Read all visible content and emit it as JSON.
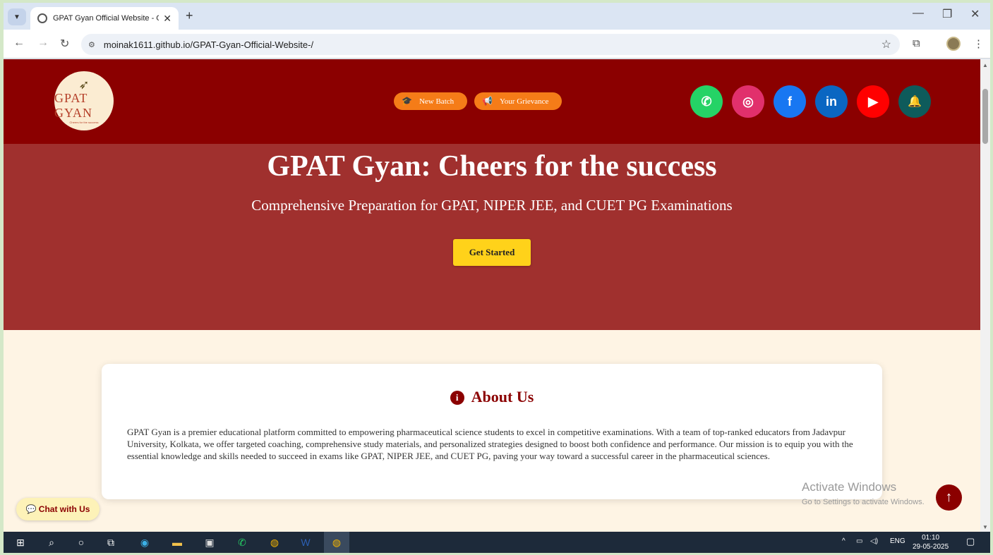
{
  "browser": {
    "tab_title": "GPAT Gyan Official Website - G",
    "url": "moinak1611.github.io/GPAT-Gyan-Official-Website-/"
  },
  "header": {
    "logo_text": "GPAT GYAN",
    "logo_tagline": "Cheers for the success",
    "buttons": [
      {
        "label": "New Batch",
        "icon": "graduation-cap-icon"
      },
      {
        "label": "Your Grievance",
        "icon": "megaphone-icon"
      }
    ],
    "socials": [
      {
        "name": "whatsapp",
        "glyph": "✆",
        "color": "#25d366"
      },
      {
        "name": "instagram",
        "glyph": "◎",
        "color": "#e1306c"
      },
      {
        "name": "facebook",
        "glyph": "f",
        "color": "#1877f2"
      },
      {
        "name": "linkedin",
        "glyph": "in",
        "color": "#0a66c2"
      },
      {
        "name": "youtube",
        "glyph": "▶",
        "color": "#ff0000"
      },
      {
        "name": "notifications",
        "glyph": "🔔",
        "color": "#0e5b5b"
      }
    ]
  },
  "hero": {
    "title": "GPAT Gyan: Cheers for the success",
    "subtitle": "Comprehensive Preparation for GPAT, NIPER JEE, and CUET PG Examinations",
    "cta": "Get Started"
  },
  "about": {
    "heading": "About Us",
    "body": "GPAT Gyan is a premier educational platform committed to empowering pharmaceutical science students to excel in competitive examinations. With a team of top-ranked educators from Jadavpur University, Kolkata, we offer targeted coaching, comprehensive study materials, and personalized strategies designed to boost both confidence and performance. Our mission is to equip you with the essential knowledge and skills needed to succeed in exams like GPAT, NIPER JEE, and CUET PG, paving your way toward a successful career in the pharmaceutical sciences."
  },
  "chat_label": "💬 Chat with Us",
  "watermark": {
    "line1": "Activate Windows",
    "line2": "Go to Settings to activate Windows."
  },
  "taskbar": {
    "language": "ENG",
    "time": "01:10",
    "date": "29-05-2025"
  }
}
